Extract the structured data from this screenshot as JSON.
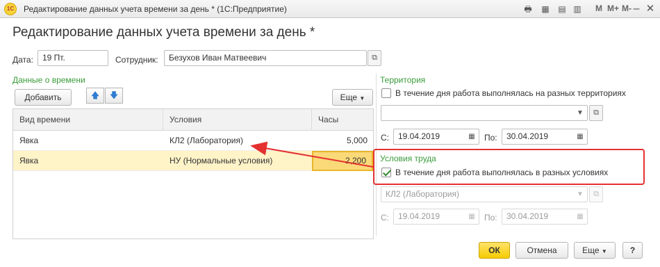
{
  "window": {
    "title": "Редактирование данных учета времени за день * (1С:Предприятие)",
    "logo": "1С",
    "toolbar_m": [
      "M",
      "M+",
      "M-"
    ]
  },
  "form": {
    "title": "Редактирование данных учета времени за день *",
    "date_label": "Дата:",
    "date_value": "19 Пт.",
    "employee_label": "Сотрудник:",
    "employee_value": "Безухов Иван Матвеевич"
  },
  "time_section": {
    "title": "Данные о времени",
    "add_button": "Добавить",
    "more_button": "Еще",
    "columns": [
      "Вид времени",
      "Условия",
      "Часы"
    ],
    "rows": [
      {
        "kind": "Явка",
        "conditions": "КЛ2 (Лаборатория)",
        "hours": "5,000"
      },
      {
        "kind": "Явка",
        "conditions": "НУ (Нормальные условия)",
        "hours": "2,200"
      }
    ]
  },
  "territory": {
    "title": "Территория",
    "checkbox_label": "В течение дня работа выполнялась на разных территориях",
    "checked": false,
    "select_value": "",
    "from_label": "С:",
    "from_value": "19.04.2019",
    "to_label": "По:",
    "to_value": "30.04.2019"
  },
  "work_conditions": {
    "title": "Условия труда",
    "checkbox_label": "В течение дня работа выполнялась в разных условиях",
    "checked": true,
    "select_value": "КЛ2 (Лаборатория)",
    "from_label": "С:",
    "from_value": "19.04.2019",
    "to_label": "По:",
    "to_value": "30.04.2019"
  },
  "footer": {
    "ok": "ОК",
    "cancel": "Отмена",
    "more": "Еще",
    "help": "?"
  },
  "colors": {
    "section_green": "#3a9b3a",
    "primary_yellow": "#f5cc00",
    "selected_row": "#fff3c8",
    "annotation_red": "#e53030"
  }
}
